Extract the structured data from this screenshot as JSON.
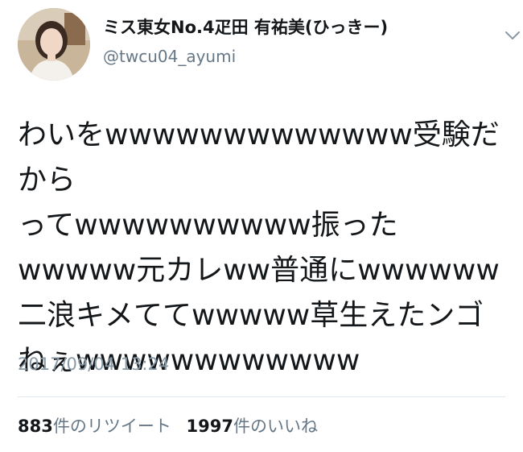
{
  "tweet": {
    "display_name": "ミス東女No.4疋田 有祐美(ひっきー)",
    "username": "@twcu04_ayumi",
    "body": "わいをwwwwwwwwwwwww受験だから\nってwwwwwwwwww振った\nwwwww元カレww普通にwwwwww\n二浪キメててwwwww草生えたンゴ\nねぇwwwwwwwwwwww",
    "timestamp": "2017/09/04 13:24",
    "retweets": {
      "count": "883",
      "label": "件のリツイート"
    },
    "likes": {
      "count": "1997",
      "label": "件のいいね"
    }
  },
  "icons": {
    "menu": "chevron-down-icon",
    "avatar": "profile-photo"
  },
  "colors": {
    "text": "#14171a",
    "secondary": "#657786",
    "timestamp": "#8899a6",
    "divider": "#e1e8ed"
  }
}
